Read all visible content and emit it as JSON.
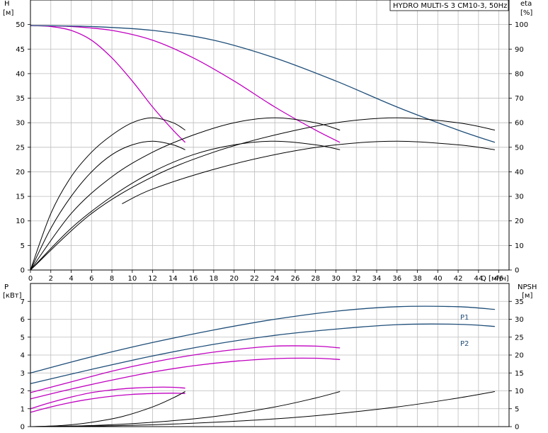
{
  "chart_data": [
    {
      "type": "line",
      "title": "HYDRO MULTI-S 3 CM10-3, 50Hz",
      "ylabel_left": "H",
      "ylabel_left_unit": "[м]",
      "ylabel_right": "eta",
      "ylabel_right_unit": "[%]",
      "xlabel": "Q [м³/ч]",
      "xlim": [
        0,
        47
      ],
      "ylim_left": [
        0,
        55
      ],
      "ylim_right": [
        0,
        110
      ],
      "grid": true,
      "x_ticks": [
        0,
        2,
        4,
        6,
        8,
        10,
        12,
        14,
        16,
        18,
        20,
        22,
        24,
        26,
        28,
        30,
        32,
        34,
        36,
        38,
        40,
        42,
        44,
        46
      ],
      "y_ticks_left": [
        0,
        5,
        10,
        15,
        20,
        25,
        30,
        35,
        40,
        45,
        50
      ],
      "y_ticks_right": [
        0,
        10,
        20,
        30,
        40,
        50,
        60,
        70,
        80,
        90,
        100
      ],
      "series": [
        {
          "color": "#c000c0",
          "axis": "left",
          "x": [
            0,
            2,
            4,
            6,
            8,
            10,
            12,
            14,
            15.2
          ],
          "y": [
            49.8,
            49.6,
            48.8,
            46.8,
            43.2,
            38.5,
            33.2,
            28.5,
            26
          ]
        },
        {
          "color": "#c000c0",
          "axis": "left",
          "x": [
            0,
            4,
            8,
            12,
            16,
            20,
            24,
            28,
            30.4
          ],
          "y": [
            49.8,
            49.6,
            48.8,
            46.8,
            43.2,
            38.5,
            33.2,
            28.5,
            26
          ]
        },
        {
          "color": "#1f4e79",
          "axis": "left",
          "x": [
            0,
            6,
            12,
            18,
            24,
            30,
            36,
            42,
            45.6
          ],
          "y": [
            49.8,
            49.6,
            48.8,
            46.8,
            43.2,
            38.5,
            33.2,
            28.5,
            26
          ]
        },
        {
          "color": "#000000",
          "axis": "right",
          "x": [
            0,
            2,
            4,
            6,
            8,
            10,
            12,
            14,
            15.2
          ],
          "y": [
            0,
            23,
            38,
            48,
            55,
            60,
            62,
            60,
            57
          ]
        },
        {
          "color": "#000000",
          "axis": "right",
          "x": [
            0,
            2,
            4,
            6,
            8,
            10,
            12,
            14,
            15.2
          ],
          "y": [
            0,
            17,
            30,
            40,
            47,
            51,
            52.5,
            51,
            49
          ]
        },
        {
          "color": "#000000",
          "axis": "right",
          "x": [
            0,
            4,
            8,
            12,
            16,
            20,
            24,
            28,
            30.4
          ],
          "y": [
            0,
            23,
            38,
            48,
            55,
            60,
            62,
            60,
            57
          ]
        },
        {
          "color": "#000000",
          "axis": "right",
          "x": [
            0,
            4,
            8,
            12,
            16,
            20,
            24,
            28,
            30.4
          ],
          "y": [
            0,
            17,
            30,
            40,
            47,
            51,
            52.5,
            51,
            49
          ]
        },
        {
          "color": "#000000",
          "axis": "right",
          "x": [
            0,
            6,
            12,
            18,
            24,
            30,
            36,
            42,
            45.6
          ],
          "y": [
            0,
            23,
            38,
            48,
            55,
            60,
            62,
            60,
            57
          ]
        },
        {
          "color": "#000000",
          "axis": "right",
          "x": [
            9,
            12,
            18,
            24,
            30,
            36,
            42,
            45.6
          ],
          "y": [
            27,
            33,
            41,
            47,
            51,
            52.5,
            51,
            49
          ]
        }
      ]
    },
    {
      "type": "line",
      "ylabel_left": "P",
      "ylabel_left_unit": "[кВт]",
      "ylabel_right": "NPSH",
      "ylabel_right_unit": "[м]",
      "xlim": [
        0,
        47
      ],
      "ylim_left": [
        0,
        8
      ],
      "ylim_right": [
        0,
        40
      ],
      "grid": true,
      "y_ticks_left": [
        0,
        1,
        2,
        3,
        4,
        5,
        6,
        7
      ],
      "y_ticks_right": [
        0,
        5,
        10,
        15,
        20,
        25,
        30,
        35
      ],
      "series": [
        {
          "name": "P1",
          "color": "#1f4e79",
          "axis": "left",
          "x": [
            0,
            6,
            12,
            18,
            24,
            30,
            36,
            42,
            45.6
          ],
          "y": [
            3.0,
            3.9,
            4.7,
            5.4,
            6.0,
            6.45,
            6.7,
            6.7,
            6.55
          ]
        },
        {
          "name": "P2",
          "color": "#1f4e79",
          "axis": "left",
          "x": [
            0,
            6,
            12,
            18,
            24,
            30,
            36,
            42,
            45.6
          ],
          "y": [
            2.4,
            3.2,
            3.95,
            4.6,
            5.1,
            5.45,
            5.7,
            5.72,
            5.6
          ]
        },
        {
          "color": "#c000c0",
          "axis": "left",
          "x": [
            0,
            4,
            8,
            12,
            16,
            20,
            24,
            28,
            30.4
          ],
          "y": [
            1.9,
            2.5,
            3.1,
            3.6,
            4.0,
            4.3,
            4.5,
            4.5,
            4.4
          ]
        },
        {
          "color": "#c000c0",
          "axis": "left",
          "x": [
            0,
            4,
            8,
            12,
            16,
            20,
            24,
            28,
            30.4
          ],
          "y": [
            1.55,
            2.1,
            2.6,
            3.05,
            3.4,
            3.65,
            3.8,
            3.82,
            3.75
          ]
        },
        {
          "color": "#c000c0",
          "axis": "left",
          "x": [
            0,
            2,
            4,
            6,
            8,
            10,
            12,
            14,
            15.2
          ],
          "y": [
            1.0,
            1.35,
            1.65,
            1.9,
            2.05,
            2.15,
            2.2,
            2.2,
            2.15
          ]
        },
        {
          "color": "#c000c0",
          "axis": "left",
          "x": [
            0,
            2,
            4,
            6,
            8,
            10,
            12,
            14,
            15.2
          ],
          "y": [
            0.8,
            1.1,
            1.35,
            1.55,
            1.7,
            1.8,
            1.85,
            1.87,
            1.85
          ]
        },
        {
          "color": "#000000",
          "axis": "right",
          "x": [
            0,
            3,
            6,
            9,
            12,
            14,
            15.2
          ],
          "y": [
            0,
            0.3,
            1.2,
            2.8,
            5.5,
            8.0,
            9.8
          ]
        },
        {
          "color": "#000000",
          "axis": "right",
          "x": [
            0,
            6,
            12,
            18,
            24,
            28,
            30.4
          ],
          "y": [
            0,
            0.3,
            1.2,
            2.8,
            5.5,
            8.0,
            9.8
          ]
        },
        {
          "color": "#000000",
          "axis": "right",
          "x": [
            0,
            9,
            18,
            27,
            36,
            42,
            45.6
          ],
          "y": [
            0,
            0.3,
            1.2,
            2.8,
            5.5,
            8.0,
            9.8
          ]
        }
      ],
      "labels": [
        "P1",
        "P2"
      ]
    }
  ]
}
